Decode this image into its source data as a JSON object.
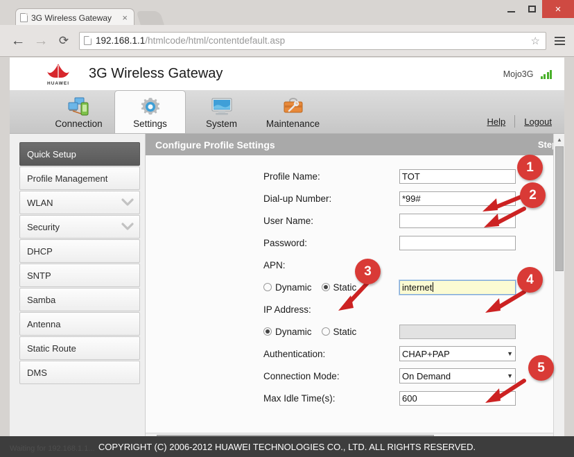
{
  "browser": {
    "tab": {
      "title": "3G Wireless Gateway",
      "close_label": "×",
      "favicon": "page-icon"
    },
    "nav": {
      "back": "←",
      "forward": "→",
      "reload": "⟳"
    },
    "url": {
      "host": "192.168.1.1",
      "path": "/htmlcode/html/contentdefault.asp"
    },
    "star_icon": "☆",
    "window": {
      "minimize": "minimize-icon",
      "maximize": "maximize-icon",
      "close": "×"
    },
    "status_text": "Waiting for 192.168.1.1..."
  },
  "header": {
    "brand_word": "HUAWEI",
    "title": "3G Wireless Gateway",
    "user": "Mojo3G",
    "signal_icon": "signal-bars-icon",
    "accent_red": "#d93a36",
    "signal_color": "#49b02a"
  },
  "nav_tabs": [
    {
      "label": "Connection",
      "icon": "network-computers-icon",
      "active": false
    },
    {
      "label": "Settings",
      "icon": "gear-icon",
      "active": true
    },
    {
      "label": "System",
      "icon": "monitor-icon",
      "active": false
    },
    {
      "label": "Maintenance",
      "icon": "toolbox-icon",
      "active": false
    }
  ],
  "header_links": {
    "help": "Help",
    "logout": "Logout"
  },
  "sidebar": {
    "items": [
      {
        "label": "Quick Setup",
        "active": true,
        "expandable": false
      },
      {
        "label": "Profile Management",
        "active": false,
        "expandable": false
      },
      {
        "label": "WLAN",
        "active": false,
        "expandable": true
      },
      {
        "label": "Security",
        "active": false,
        "expandable": true
      },
      {
        "label": "DHCP",
        "active": false,
        "expandable": false
      },
      {
        "label": "SNTP",
        "active": false,
        "expandable": false
      },
      {
        "label": "Samba",
        "active": false,
        "expandable": false
      },
      {
        "label": "Antenna",
        "active": false,
        "expandable": false
      },
      {
        "label": "Static Route",
        "active": false,
        "expandable": false
      },
      {
        "label": "DMS",
        "active": false,
        "expandable": false
      }
    ],
    "chevron_icon": "chevron-down-icon"
  },
  "panel": {
    "title": "Configure Profile Settings",
    "step_label": "Step",
    "fields": {
      "profile_name": {
        "label": "Profile Name:",
        "value": "TOT"
      },
      "dialup_number": {
        "label": "Dial-up Number:",
        "value": "*99#"
      },
      "user_name": {
        "label": "User Name:",
        "value": ""
      },
      "password": {
        "label": "Password:",
        "value": ""
      },
      "apn": {
        "label": "APN:",
        "options": [
          "Dynamic",
          "Static"
        ],
        "selected": "Static",
        "value": "internet"
      },
      "ip_address": {
        "label": "IP Address:",
        "options": [
          "Dynamic",
          "Static"
        ],
        "selected": "Dynamic",
        "value": ""
      },
      "authentication": {
        "label": "Authentication:",
        "value": "CHAP+PAP",
        "arrow": "▼"
      },
      "connection_mode": {
        "label": "Connection Mode:",
        "value": "On Demand",
        "arrow": "▼"
      },
      "max_idle_time": {
        "label": "Max Idle Time(s):",
        "value": "600"
      }
    }
  },
  "scrollbars": {
    "up_arrow": "▲",
    "down_arrow": "▼",
    "left_arrow": "◀",
    "right_arrow": "▶"
  },
  "footer": {
    "copyright": "COPYRIGHT (C) 2006-2012 HUAWEI TECHNOLOGIES CO., LTD. ALL RIGHTS RESERVED."
  },
  "annotations": [
    {
      "number": "1"
    },
    {
      "number": "2"
    },
    {
      "number": "3"
    },
    {
      "number": "4"
    },
    {
      "number": "5"
    }
  ]
}
